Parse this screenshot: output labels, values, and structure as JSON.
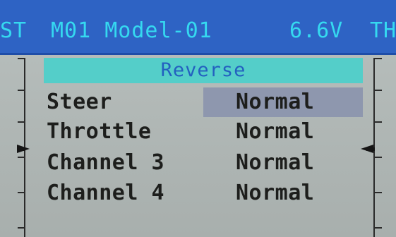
{
  "header": {
    "left_tab": "ST",
    "model": "M01 Model-01",
    "voltage": "6.6V",
    "right_tab": "TH"
  },
  "screen": {
    "title": "Reverse",
    "rows": [
      {
        "name": "Steer",
        "value": "Normal",
        "selected": true
      },
      {
        "name": "Throttle",
        "value": "Normal",
        "selected": false
      },
      {
        "name": "Channel 3",
        "value": "Normal",
        "selected": false
      },
      {
        "name": "Channel 4",
        "value": "Normal",
        "selected": false
      }
    ]
  },
  "icons": {
    "left_trim_marker": "triangle-right",
    "right_trim_marker": "triangle-left"
  },
  "colors": {
    "header_bg": "#2e63c4",
    "header_text": "#35d9f0",
    "title_bg": "#54cec9",
    "title_text": "#2360c0",
    "screen_bg": "#b1b8b6",
    "selection_bg": "#8e97ae",
    "text": "#1d1e1c"
  }
}
